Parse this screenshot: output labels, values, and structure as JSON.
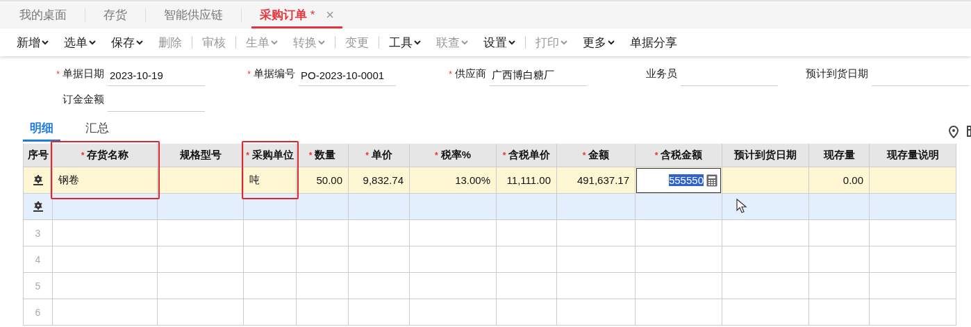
{
  "tabs": [
    {
      "label": "我的桌面",
      "selected": false
    },
    {
      "label": "存货",
      "selected": false
    },
    {
      "label": "智能供应链",
      "selected": false
    },
    {
      "label": "采购订单",
      "selected": true,
      "modified_mark": "*",
      "close": "×"
    }
  ],
  "toolbar": [
    {
      "kind": "button",
      "label": "新增",
      "disabled": false,
      "dropdown": true
    },
    {
      "kind": "button",
      "label": "选单",
      "disabled": false,
      "dropdown": true
    },
    {
      "kind": "button",
      "label": "保存",
      "disabled": false,
      "dropdown": true
    },
    {
      "kind": "button",
      "label": "删除",
      "disabled": true,
      "dropdown": false
    },
    {
      "kind": "separator"
    },
    {
      "kind": "button",
      "label": "审核",
      "disabled": true,
      "dropdown": false
    },
    {
      "kind": "separator"
    },
    {
      "kind": "button",
      "label": "生单",
      "disabled": true,
      "dropdown": true
    },
    {
      "kind": "button",
      "label": "转换",
      "disabled": true,
      "dropdown": true
    },
    {
      "kind": "separator"
    },
    {
      "kind": "button",
      "label": "变更",
      "disabled": true,
      "dropdown": false
    },
    {
      "kind": "separator"
    },
    {
      "kind": "button",
      "label": "工具",
      "disabled": false,
      "dropdown": true
    },
    {
      "kind": "button",
      "label": "联查",
      "disabled": true,
      "dropdown": true
    },
    {
      "kind": "button",
      "label": "设置",
      "disabled": false,
      "dropdown": true
    },
    {
      "kind": "separator"
    },
    {
      "kind": "button",
      "label": "打印",
      "disabled": true,
      "dropdown": true
    },
    {
      "kind": "button",
      "label": "更多",
      "disabled": false,
      "dropdown": true
    },
    {
      "kind": "button",
      "label": "单据分享",
      "disabled": false,
      "dropdown": false
    }
  ],
  "form_fields": [
    {
      "label": "单据日期",
      "required": true,
      "value": "2023-10-19"
    },
    {
      "label": "单据编号",
      "required": true,
      "value": "PO-2023-10-0001"
    },
    {
      "label": "供应商",
      "required": true,
      "value": "广西博白糖厂"
    },
    {
      "label": "业务员",
      "required": false
    },
    {
      "label": "预计到货日期",
      "required": false
    },
    {
      "label": "订金金额",
      "required": false
    }
  ],
  "detail_tabs": [
    {
      "label": "明细",
      "selected": true
    },
    {
      "label": "汇总",
      "selected": false
    }
  ],
  "table": {
    "columns": [
      {
        "label": "序号",
        "required": false,
        "highlighted": false
      },
      {
        "label": "存货名称",
        "required": true,
        "highlighted": true
      },
      {
        "label": "规格型号",
        "required": false,
        "highlighted": false
      },
      {
        "label": "采购单位",
        "required": true,
        "highlighted": true
      },
      {
        "label": "数量",
        "required": true,
        "highlighted": false,
        "numeric": true
      },
      {
        "label": "单价",
        "required": true,
        "highlighted": false,
        "numeric": true
      },
      {
        "label": "税率%",
        "required": true,
        "highlighted": false,
        "numeric": true
      },
      {
        "label": "含税单价",
        "required": true,
        "highlighted": false,
        "numeric": true
      },
      {
        "label": "金额",
        "required": true,
        "highlighted": false,
        "numeric": true
      },
      {
        "label": "含税金额",
        "required": true,
        "highlighted": false,
        "numeric": true
      },
      {
        "label": "预计到货日期",
        "required": false,
        "highlighted": false
      },
      {
        "label": "现存量",
        "required": false,
        "highlighted": false,
        "numeric": true
      },
      {
        "label": "现存量说明",
        "required": false,
        "highlighted": false
      }
    ],
    "rows": [
      {
        "kind": "gear",
        "selected": true,
        "hovered": false,
        "cells": [
          "",
          "钢卷",
          "",
          "吨",
          "50.00",
          "9,832.74",
          "13.00%",
          "11,111.00",
          "491,637.17",
          {
            "value": "555550",
            "editing": true
          },
          "",
          "0.00",
          ""
        ]
      },
      {
        "kind": "gear",
        "selected": false,
        "hovered": true,
        "cells": [
          ""
        ]
      },
      {
        "kind": "number",
        "selected": false,
        "hovered": false,
        "cells": [
          "3"
        ]
      },
      {
        "kind": "number",
        "selected": false,
        "hovered": false,
        "cells": [
          "4"
        ]
      },
      {
        "kind": "number",
        "selected": false,
        "hovered": false,
        "cells": [
          "5"
        ]
      },
      {
        "kind": "number",
        "selected": false,
        "hovered": false,
        "cells": [
          "6"
        ]
      }
    ]
  }
}
